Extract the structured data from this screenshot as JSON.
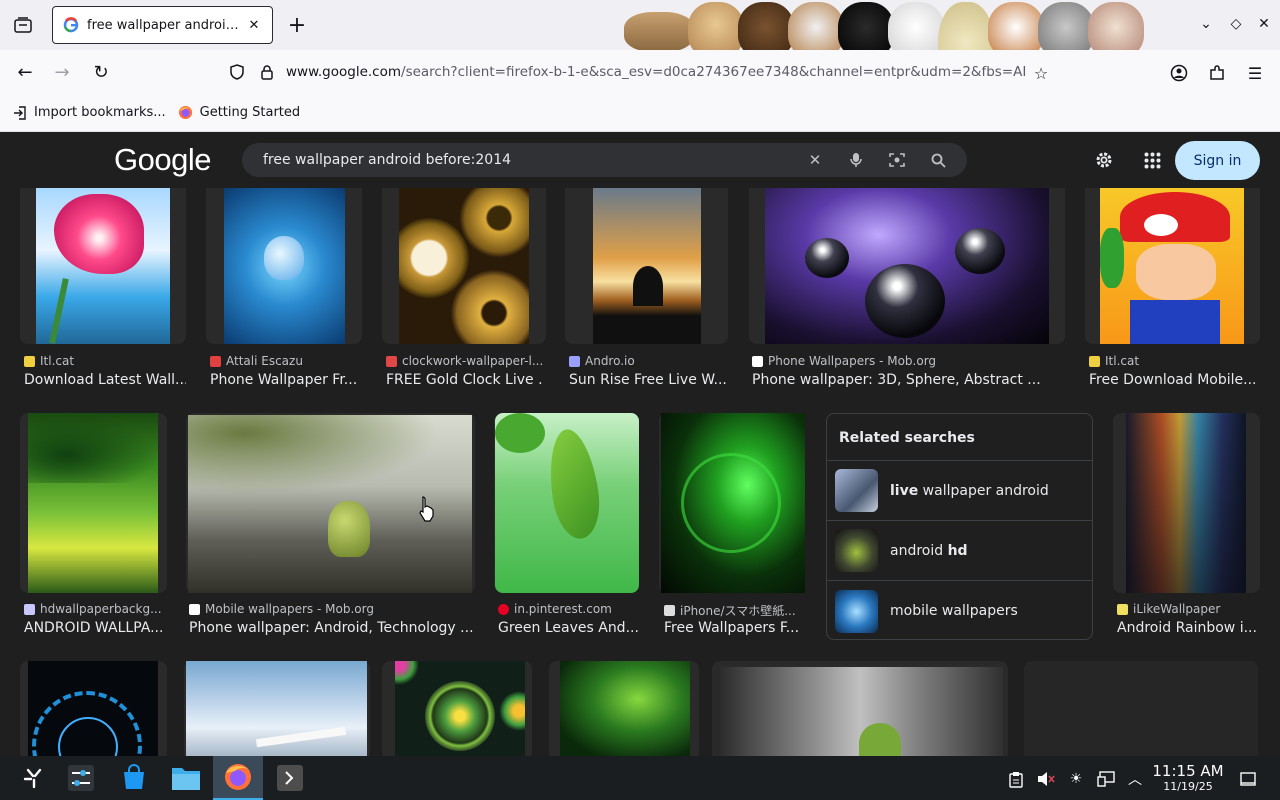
{
  "browser": {
    "tab_title": "free wallpaper android before:2014",
    "url_domain": "www.google.com",
    "url_path": "/search?client=firefox-b-1-e&sca_esv=d0ca274367ee7348&channel=entpr&udm=2&fbs=AIIjpHx",
    "bookmarks": [
      {
        "label": "Import bookmarks...",
        "icon": "import-icon"
      },
      {
        "label": "Getting Started",
        "icon": "firefox-icon"
      }
    ]
  },
  "google": {
    "logo": "Google",
    "query": "free wallpaper android before:2014",
    "signin_label": "Sign in"
  },
  "results_row1": [
    {
      "source": "Itl.cat",
      "title": "Download Latest Wall...",
      "fav": "#f0d040"
    },
    {
      "source": "Attali Escazu",
      "title": "Phone Wallpaper Fr...",
      "fav": "#e04040"
    },
    {
      "source": "clockwork-wallpaper-l...",
      "title": "FREE Gold Clock Live ...",
      "fav": "#e04848"
    },
    {
      "source": "Andro.io",
      "title": "Sun Rise Free Live W...",
      "fav": "#9aa0ff"
    },
    {
      "source": "Phone Wallpapers - Mob.org",
      "title": "Phone wallpaper: 3D, Sphere, Abstract ...",
      "fav": "#ffffff"
    },
    {
      "source": "Itl.cat",
      "title": "Free Download Mobile...",
      "fav": "#f0d040"
    }
  ],
  "results_row2": [
    {
      "source": "hdwallpaperbackg...",
      "title": "ANDROID WALLPA...",
      "fav": "#c8c8ff"
    },
    {
      "source": "Mobile wallpapers - Mob.org",
      "title": "Phone wallpaper: Android, Technology ...",
      "fav": "#ffffff"
    },
    {
      "source": "in.pinterest.com",
      "title": "Green Leaves And...",
      "fav": "#e60023"
    },
    {
      "source": "iPhone/スマホ壁紙...",
      "title": "Free Wallpapers F...",
      "fav": "#dddddd"
    },
    {
      "source": "iLikeWallpaper",
      "title": "Android Rainbow i...",
      "fav": "#f0e060"
    }
  ],
  "related": {
    "header": "Related searches",
    "items": [
      {
        "bold": "live",
        "rest": " wallpaper android"
      },
      {
        "plain": "android ",
        "bold": "hd"
      },
      {
        "plain": "mobile wallpapers",
        "bold": ""
      }
    ]
  },
  "taskbar": {
    "time": "11:15 AM",
    "date": "11/19/25"
  }
}
